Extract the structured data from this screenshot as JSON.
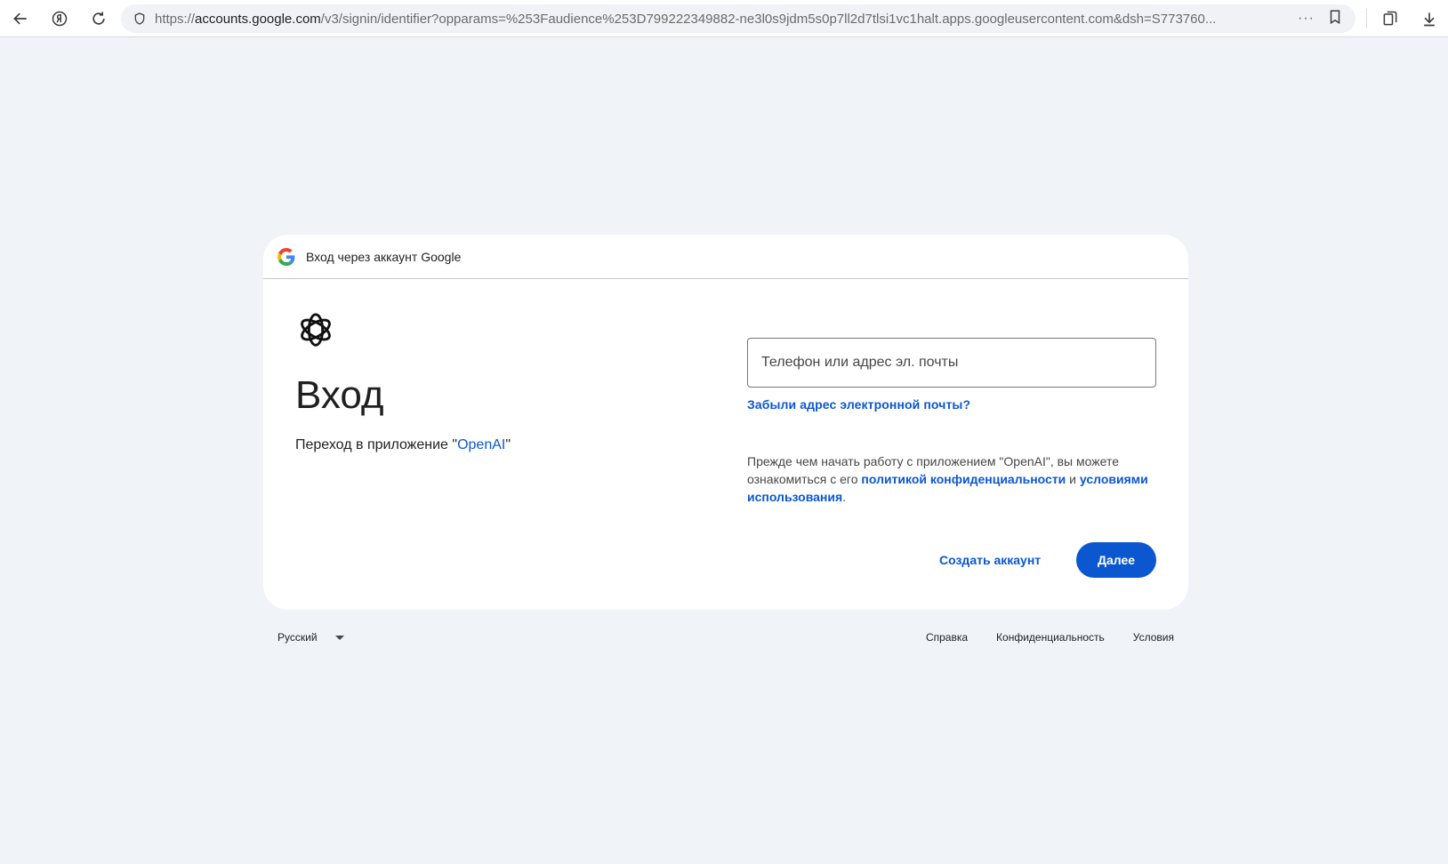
{
  "browser": {
    "url_prefix": "https://",
    "url_domain": "accounts.google.com",
    "url_rest": "/v3/signin/identifier?opparams=%253Faudience%253D799222349882-ne3l0s9jdm5s0p7ll2d7tlsi1vc1halt.apps.googleusercontent.com&dsh=S773760...",
    "more_label": "···"
  },
  "card": {
    "header_text": "Вход через аккаунт Google",
    "title": "Вход",
    "subtitle_prefix": "Переход в приложение \"",
    "subtitle_app": "OpenAI",
    "subtitle_suffix": "\"",
    "email_placeholder": "Телефон или адрес эл. почты",
    "forgot_link": "Забыли адрес электронной почты?",
    "privacy_prefix": "Прежде чем начать работу с приложением \"OpenAI\", вы можете ознакомиться с его ",
    "privacy_link": "политикой конфиденциальности",
    "privacy_and": " и ",
    "terms_link": "условиями использования",
    "privacy_suffix": ".",
    "create_account": "Создать аккаунт",
    "next": "Далее"
  },
  "footer": {
    "language": "Русский",
    "links": [
      "Справка",
      "Конфиденциальность",
      "Условия"
    ]
  },
  "colors": {
    "page_bg": "#f0f4f9",
    "accent": "#0b57d0"
  }
}
